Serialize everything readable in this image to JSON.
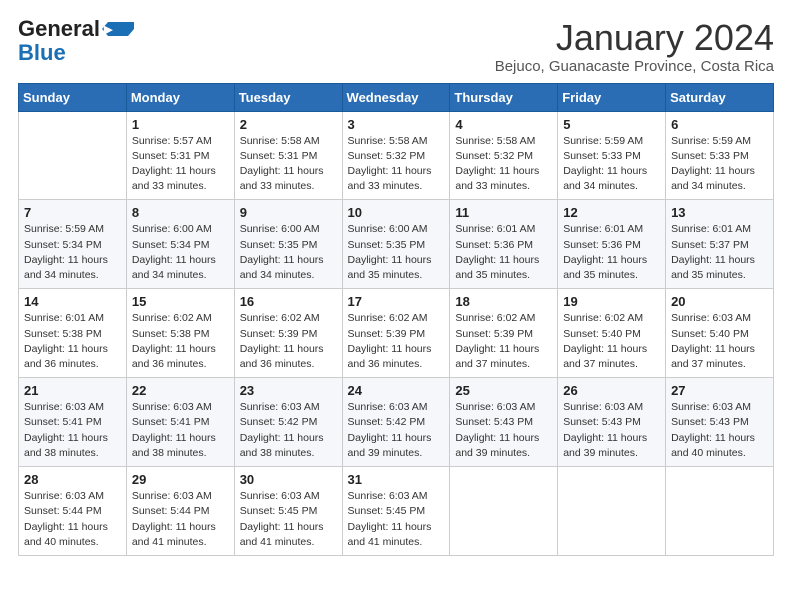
{
  "logo": {
    "general": "General",
    "blue": "Blue"
  },
  "header": {
    "month_title": "January 2024",
    "location": "Bejuco, Guanacaste Province, Costa Rica"
  },
  "weekdays": [
    "Sunday",
    "Monday",
    "Tuesday",
    "Wednesday",
    "Thursday",
    "Friday",
    "Saturday"
  ],
  "weeks": [
    [
      {
        "day": "",
        "info": ""
      },
      {
        "day": "1",
        "info": "Sunrise: 5:57 AM\nSunset: 5:31 PM\nDaylight: 11 hours\nand 33 minutes."
      },
      {
        "day": "2",
        "info": "Sunrise: 5:58 AM\nSunset: 5:31 PM\nDaylight: 11 hours\nand 33 minutes."
      },
      {
        "day": "3",
        "info": "Sunrise: 5:58 AM\nSunset: 5:32 PM\nDaylight: 11 hours\nand 33 minutes."
      },
      {
        "day": "4",
        "info": "Sunrise: 5:58 AM\nSunset: 5:32 PM\nDaylight: 11 hours\nand 33 minutes."
      },
      {
        "day": "5",
        "info": "Sunrise: 5:59 AM\nSunset: 5:33 PM\nDaylight: 11 hours\nand 34 minutes."
      },
      {
        "day": "6",
        "info": "Sunrise: 5:59 AM\nSunset: 5:33 PM\nDaylight: 11 hours\nand 34 minutes."
      }
    ],
    [
      {
        "day": "7",
        "info": "Sunrise: 5:59 AM\nSunset: 5:34 PM\nDaylight: 11 hours\nand 34 minutes."
      },
      {
        "day": "8",
        "info": "Sunrise: 6:00 AM\nSunset: 5:34 PM\nDaylight: 11 hours\nand 34 minutes."
      },
      {
        "day": "9",
        "info": "Sunrise: 6:00 AM\nSunset: 5:35 PM\nDaylight: 11 hours\nand 34 minutes."
      },
      {
        "day": "10",
        "info": "Sunrise: 6:00 AM\nSunset: 5:35 PM\nDaylight: 11 hours\nand 35 minutes."
      },
      {
        "day": "11",
        "info": "Sunrise: 6:01 AM\nSunset: 5:36 PM\nDaylight: 11 hours\nand 35 minutes."
      },
      {
        "day": "12",
        "info": "Sunrise: 6:01 AM\nSunset: 5:36 PM\nDaylight: 11 hours\nand 35 minutes."
      },
      {
        "day": "13",
        "info": "Sunrise: 6:01 AM\nSunset: 5:37 PM\nDaylight: 11 hours\nand 35 minutes."
      }
    ],
    [
      {
        "day": "14",
        "info": "Sunrise: 6:01 AM\nSunset: 5:38 PM\nDaylight: 11 hours\nand 36 minutes."
      },
      {
        "day": "15",
        "info": "Sunrise: 6:02 AM\nSunset: 5:38 PM\nDaylight: 11 hours\nand 36 minutes."
      },
      {
        "day": "16",
        "info": "Sunrise: 6:02 AM\nSunset: 5:39 PM\nDaylight: 11 hours\nand 36 minutes."
      },
      {
        "day": "17",
        "info": "Sunrise: 6:02 AM\nSunset: 5:39 PM\nDaylight: 11 hours\nand 36 minutes."
      },
      {
        "day": "18",
        "info": "Sunrise: 6:02 AM\nSunset: 5:39 PM\nDaylight: 11 hours\nand 37 minutes."
      },
      {
        "day": "19",
        "info": "Sunrise: 6:02 AM\nSunset: 5:40 PM\nDaylight: 11 hours\nand 37 minutes."
      },
      {
        "day": "20",
        "info": "Sunrise: 6:03 AM\nSunset: 5:40 PM\nDaylight: 11 hours\nand 37 minutes."
      }
    ],
    [
      {
        "day": "21",
        "info": "Sunrise: 6:03 AM\nSunset: 5:41 PM\nDaylight: 11 hours\nand 38 minutes."
      },
      {
        "day": "22",
        "info": "Sunrise: 6:03 AM\nSunset: 5:41 PM\nDaylight: 11 hours\nand 38 minutes."
      },
      {
        "day": "23",
        "info": "Sunrise: 6:03 AM\nSunset: 5:42 PM\nDaylight: 11 hours\nand 38 minutes."
      },
      {
        "day": "24",
        "info": "Sunrise: 6:03 AM\nSunset: 5:42 PM\nDaylight: 11 hours\nand 39 minutes."
      },
      {
        "day": "25",
        "info": "Sunrise: 6:03 AM\nSunset: 5:43 PM\nDaylight: 11 hours\nand 39 minutes."
      },
      {
        "day": "26",
        "info": "Sunrise: 6:03 AM\nSunset: 5:43 PM\nDaylight: 11 hours\nand 39 minutes."
      },
      {
        "day": "27",
        "info": "Sunrise: 6:03 AM\nSunset: 5:43 PM\nDaylight: 11 hours\nand 40 minutes."
      }
    ],
    [
      {
        "day": "28",
        "info": "Sunrise: 6:03 AM\nSunset: 5:44 PM\nDaylight: 11 hours\nand 40 minutes."
      },
      {
        "day": "29",
        "info": "Sunrise: 6:03 AM\nSunset: 5:44 PM\nDaylight: 11 hours\nand 41 minutes."
      },
      {
        "day": "30",
        "info": "Sunrise: 6:03 AM\nSunset: 5:45 PM\nDaylight: 11 hours\nand 41 minutes."
      },
      {
        "day": "31",
        "info": "Sunrise: 6:03 AM\nSunset: 5:45 PM\nDaylight: 11 hours\nand 41 minutes."
      },
      {
        "day": "",
        "info": ""
      },
      {
        "day": "",
        "info": ""
      },
      {
        "day": "",
        "info": ""
      }
    ]
  ]
}
